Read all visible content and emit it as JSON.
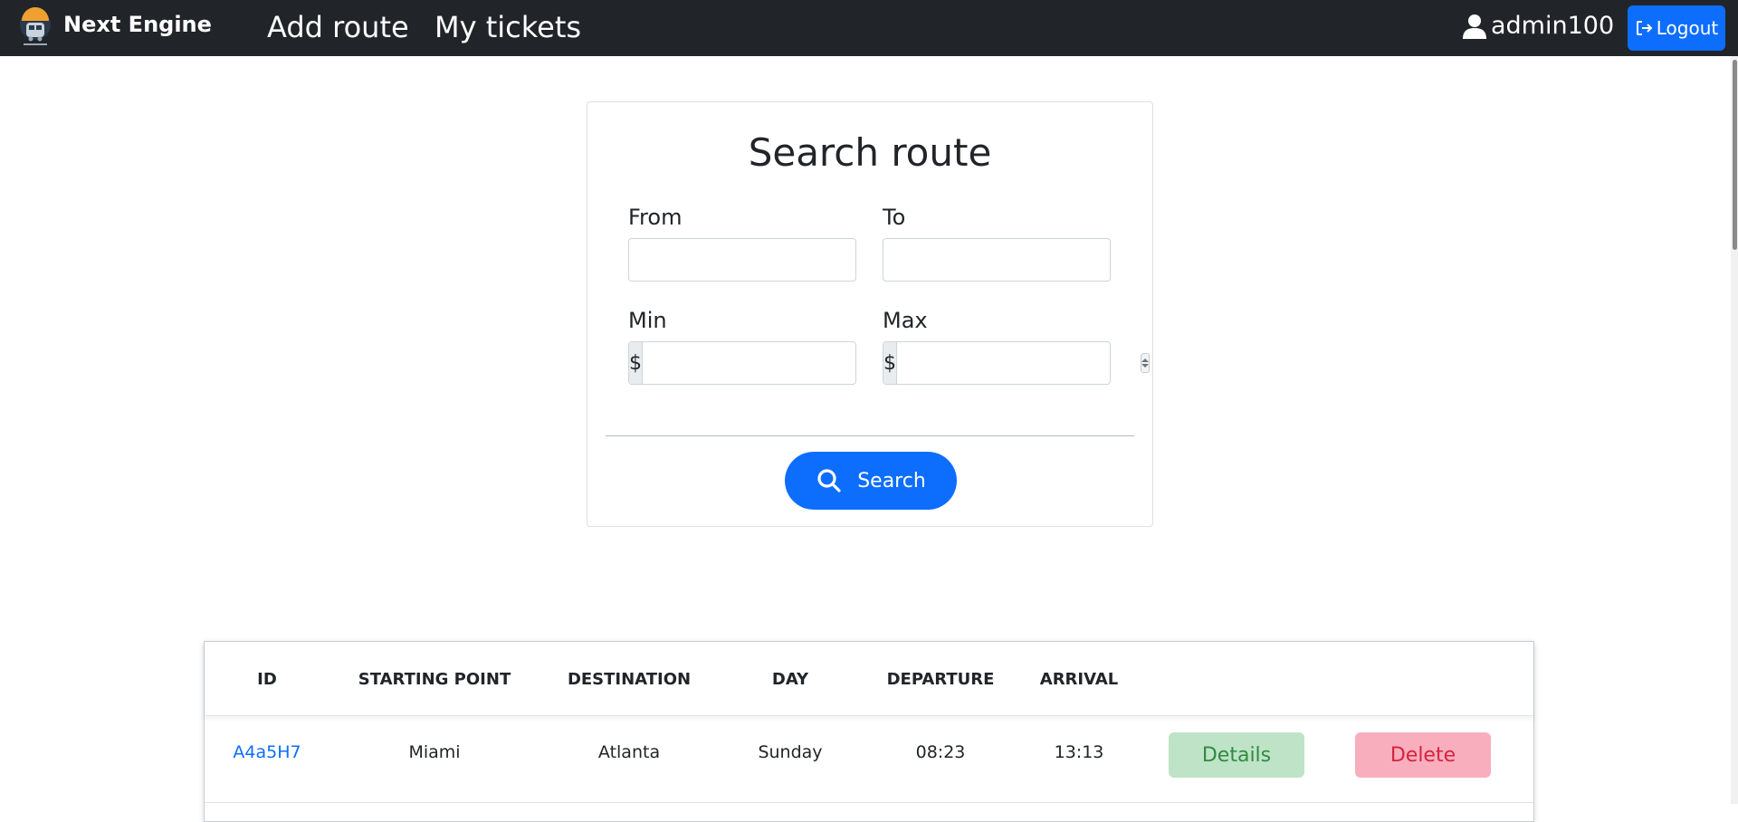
{
  "navbar": {
    "brand": "Next Engine",
    "links": [
      "Add route",
      "My tickets"
    ],
    "username": "admin100",
    "logout_label": "Logout"
  },
  "search": {
    "title": "Search route",
    "from_label": "From",
    "to_label": "To",
    "min_label": "Min",
    "max_label": "Max",
    "currency": "$",
    "from_value": "",
    "to_value": "",
    "min_value": "",
    "max_value": "",
    "button_label": "Search"
  },
  "table": {
    "headers": [
      "ID",
      "STARTING POINT",
      "DESTINATION",
      "DAY",
      "DEPARTURE",
      "ARRIVAL"
    ],
    "rows": [
      {
        "id": "A4a5H7",
        "from": "Miami",
        "to": "Atlanta",
        "day": "Sunday",
        "departure": "08:23",
        "arrival": "13:13",
        "details_label": "Details",
        "delete_label": "Delete"
      }
    ]
  },
  "colors": {
    "navbar_bg": "#212529",
    "primary": "#0d6efd",
    "details_bg": "#bfe3c6",
    "delete_bg": "#f9aebd"
  },
  "icons": {
    "brand": "train-logo-icon",
    "user": "user-icon",
    "logout": "logout-icon",
    "search": "magnifier-icon"
  }
}
